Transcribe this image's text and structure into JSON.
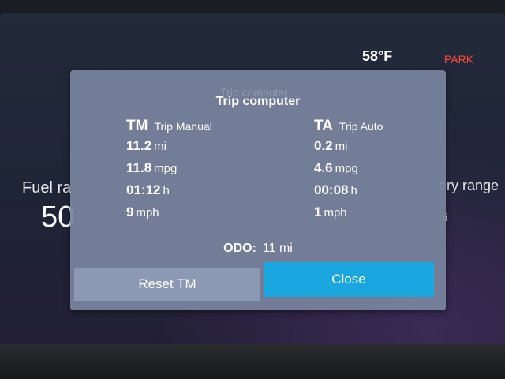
{
  "status": {
    "temperature": "58°F",
    "gear": "PARK"
  },
  "background": {
    "fuel_range_label": "Fuel ra",
    "fuel_range_value": "50",
    "battery_range_label": "ery range",
    "battery_range_unit": "ni"
  },
  "dialog": {
    "ghost_title": "Trip computer",
    "title": "Trip computer",
    "trip_manual": {
      "abbr": "TM",
      "name": "Trip Manual",
      "stats": [
        {
          "value": "11.2",
          "unit": "mi"
        },
        {
          "value": "11.8",
          "unit": "mpg"
        },
        {
          "value": "01:12",
          "unit": "h"
        },
        {
          "value": "9",
          "unit": "mph"
        }
      ]
    },
    "trip_auto": {
      "abbr": "TA",
      "name": "Trip Auto",
      "stats": [
        {
          "value": "0.2",
          "unit": "mi"
        },
        {
          "value": "4.6",
          "unit": "mpg"
        },
        {
          "value": "00:08",
          "unit": "h"
        },
        {
          "value": "1",
          "unit": "mph"
        }
      ]
    },
    "odo_label": "ODO:",
    "odo_value": "11 mi",
    "reset_label": "Reset TM",
    "close_label": "Close"
  },
  "colors": {
    "close_button": "#1aa7e0",
    "reset_button": "#8c98b4",
    "gear_text": "#ff4a3a"
  }
}
